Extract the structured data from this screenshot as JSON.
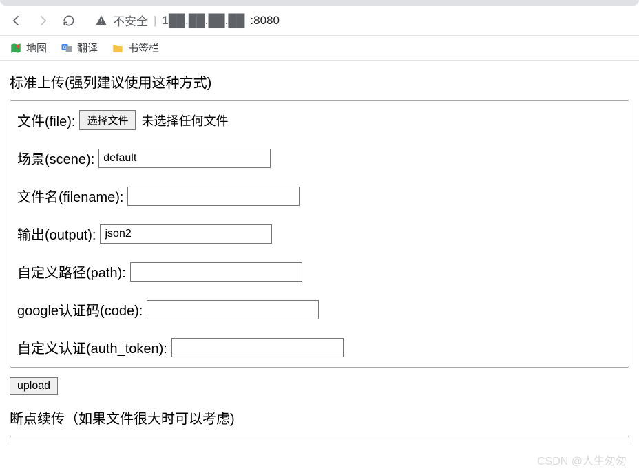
{
  "browser": {
    "insecure_label": "不安全",
    "address_host_hidden": "1██.██.██.██",
    "address_port": ":8080"
  },
  "bookmarks": {
    "maps": "地图",
    "translate": "翻译",
    "bookmarks_bar": "书签栏"
  },
  "form": {
    "section1_title": "标准上传(强列建议使用这种方式)",
    "file_label": "文件(file):",
    "file_button": "选择文件",
    "file_status": "未选择任何文件",
    "scene_label": "场景(scene):",
    "scene_value": "default",
    "filename_label": "文件名(filename):",
    "filename_value": "",
    "output_label": "输出(output):",
    "output_value": "json2",
    "path_label": "自定义路径(path):",
    "path_value": "",
    "code_label": "google认证码(code):",
    "code_value": "",
    "auth_label": "自定义认证(auth_token):",
    "auth_value": "",
    "upload_button": "upload",
    "section2_title": "断点续传（如果文件很大时可以考虑)"
  },
  "watermark": "CSDN @人生匆匆"
}
